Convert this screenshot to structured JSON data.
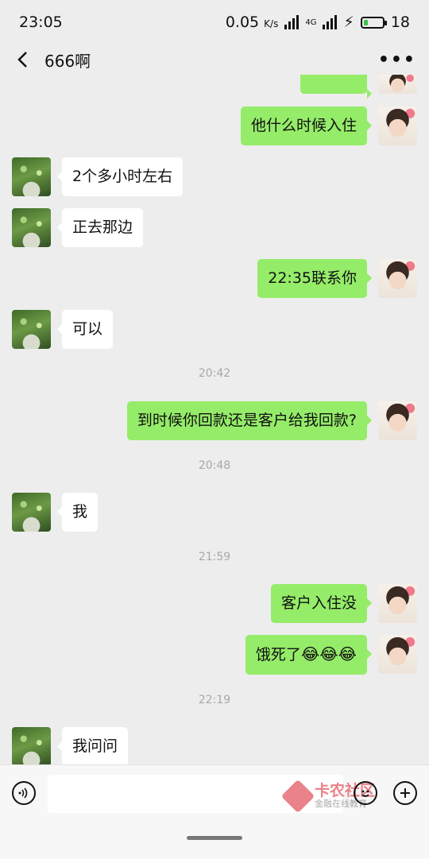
{
  "statusbar": {
    "time": "23:05",
    "speed": "0.05",
    "speed_unit": "K/s",
    "network": "4G",
    "battery_text": "18"
  },
  "header": {
    "title": "666啊"
  },
  "messages": [
    {
      "side": "out",
      "text": ""
    },
    {
      "side": "out",
      "text": "他什么时候入住"
    },
    {
      "side": "in",
      "text": "2个多小时左右"
    },
    {
      "side": "in",
      "text": "正去那边"
    },
    {
      "side": "out",
      "text": "22:35联系你"
    },
    {
      "side": "in",
      "text": "可以"
    },
    {
      "side": "time",
      "text": "20:42"
    },
    {
      "side": "out",
      "text": "到时候你回款还是客户给我回款?"
    },
    {
      "side": "time",
      "text": "20:48"
    },
    {
      "side": "in",
      "text": "我"
    },
    {
      "side": "time",
      "text": "21:59"
    },
    {
      "side": "out",
      "text": "客户入住没"
    },
    {
      "side": "out",
      "text": "饿死了",
      "emojis": "😂😂😂"
    },
    {
      "side": "time",
      "text": "22:19"
    },
    {
      "side": "in",
      "text": "我问问"
    }
  ],
  "composer": {
    "placeholder": ""
  },
  "watermark": {
    "main": "卡农社区",
    "sub": "金融在线教育"
  }
}
